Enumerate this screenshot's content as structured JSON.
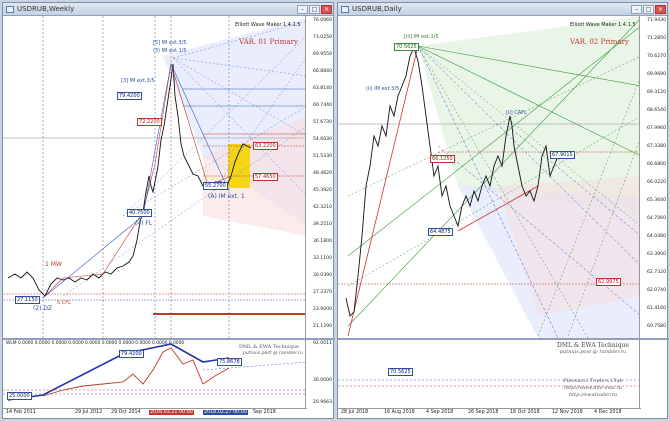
{
  "left_window": {
    "title": "USDRUB,Weekly",
    "indicator_label": "Elliott Wave Maker 1.4.1.5",
    "variant_label": "VAR. 01 Primary",
    "price_ticks": [
      "76.0960",
      "73.0250",
      "69.9550",
      "66.8840",
      "63.8140",
      "60.7440",
      "57.6730",
      "54.6030",
      "51.5330",
      "48.4620",
      "45.3920",
      "42.3210",
      "39.2510",
      "36.1800",
      "33.1100",
      "30.0390",
      "27.2370",
      "23.9000",
      "21.1290"
    ],
    "wave_labels": {
      "im_ext_a": "[5] IM ext.3/5",
      "im_ext_b": "[3] IM ext.3/5",
      "im_ext_c": "(3) IM ext.1/5",
      "mw": "1 MW",
      "dz": "(2) DZ",
      "fl": "(4) FL",
      "cfl": "5 CFL",
      "im_ext1": "(A) IM ext. 1",
      "dml_ewa": "DML & EWA Technique",
      "email": "putnuis.post @ rambler.ru"
    },
    "price_boxes": {
      "b1": "79.4200",
      "b2": "40.7500",
      "b3": "27.1150",
      "b4": "72.2200",
      "b5": "55.2700",
      "b6": "63.2200",
      "b7": "57.4650"
    },
    "sub_window": {
      "title": "WLM 0.0000 0.0000 0.0000 0.0000 0.0000 0.0000 0.0000 0.0000 0.0000 0.0000",
      "ticks": [
        "92.0011",
        "30.0000",
        "20.9663"
      ],
      "boxes": [
        "79.4200",
        "75.8678",
        "25.0000"
      ],
      "dml": "DML & EWA Technique",
      "email": "putnuis.post @ rambler.ru"
    },
    "x_ticks": [
      "14 Feb 2011",
      "29 Jul 2012",
      "29 Oct 2014",
      "2016.03.21 00:00",
      "2018.02.27 00:00",
      "Sep 2018"
    ]
  },
  "right_window": {
    "title": "USDRUB,Daily",
    "indicator_label": "Elliott Wave Maker 1.4.1.5",
    "variant_label": "VAR. 02 Primary",
    "price_ticks": [
      "71.9430",
      "71.2850",
      "70.6270",
      "69.9690",
      "69.3120",
      "68.6540",
      "67.9960",
      "67.3380",
      "66.6800",
      "66.0220",
      "65.3640",
      "64.7060",
      "64.0480",
      "63.3900",
      "62.7320",
      "62.0740",
      "61.4160",
      "60.7580"
    ],
    "wave_labels": {
      "im_ext_top": "[iii] IM ext.1/5",
      "cafl": "[ii] CAFL",
      "im_ext_low": "(ii) IM ext.3/5"
    },
    "price_boxes": {
      "b1": "70.5625",
      "b2": "66.1250",
      "b3": "64.4875",
      "b4": "67.9015",
      "b5": "62.9975"
    },
    "sub_box": "70.5625",
    "credits": {
      "dml": "DML & EWA Technique",
      "email": "putnuis.post @ rambler.ru",
      "club": "Fibonacci Traders Club",
      "site1": "http://www.dml-ewa.ru",
      "site2": "http://ewatrader.ru"
    },
    "x_ticks": [
      "28 Jul 2018",
      "16 Aug 2018",
      "4 Sep 2018",
      "26 Sep 2018",
      "18 Oct 2018",
      "12 Nov 2018",
      "4 Dec 2018"
    ]
  },
  "colors": {
    "accent_red": "#c0392b",
    "fib_blue": "#3a5bd0",
    "fib_green": "#3a9a3a",
    "highlight_yellow": "#f5d400"
  }
}
